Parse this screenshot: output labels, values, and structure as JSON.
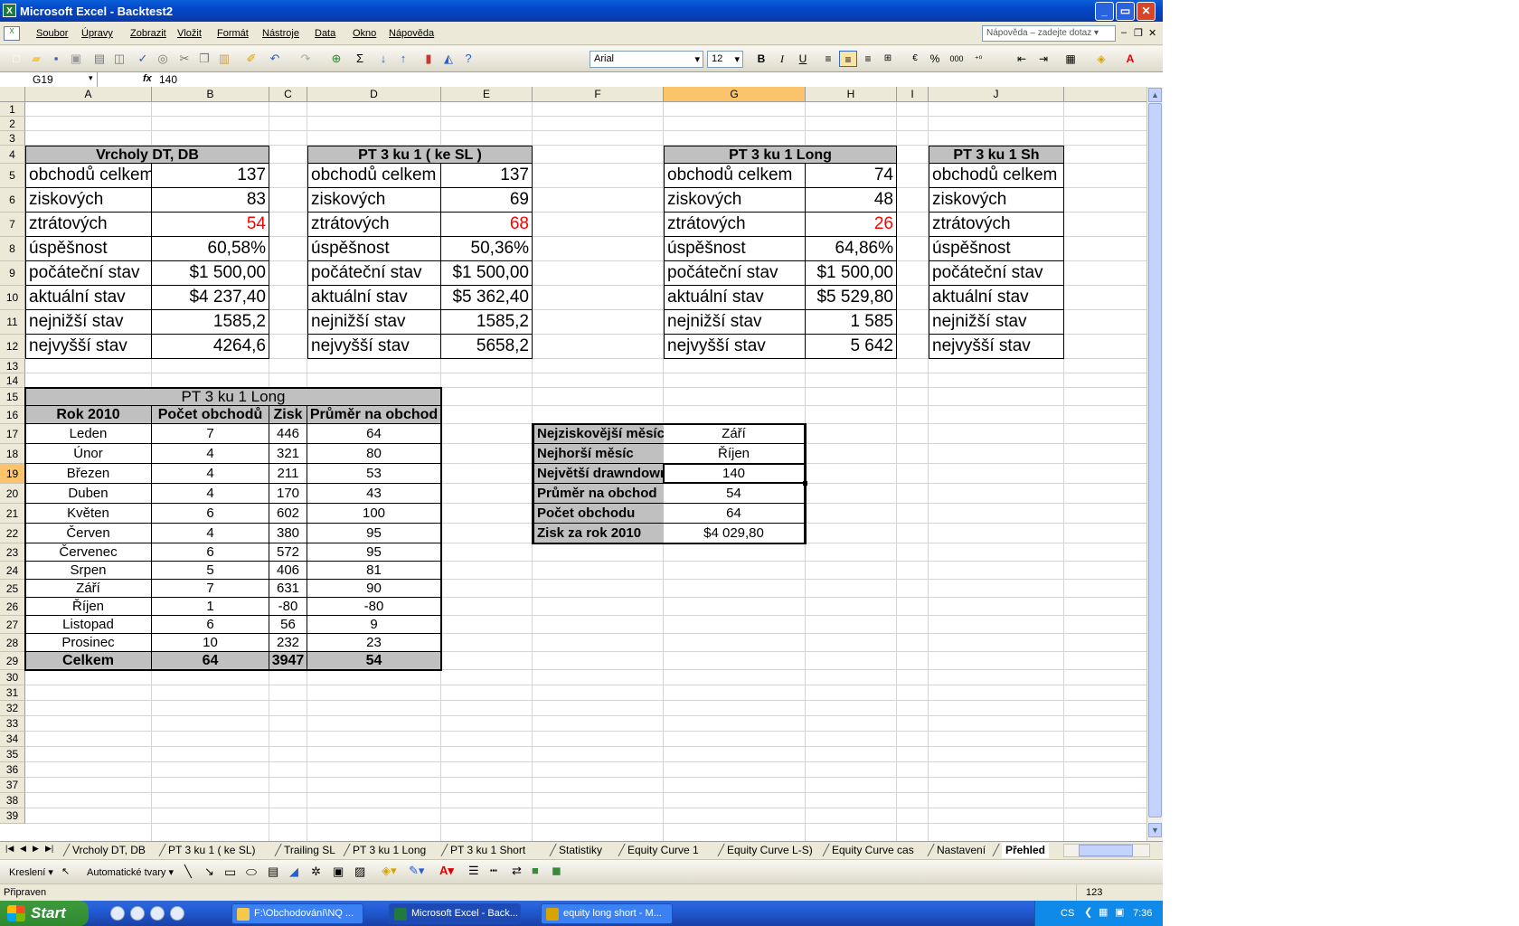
{
  "window": {
    "title": "Microsoft Excel - Backtest2"
  },
  "menu": [
    "Soubor",
    "Úpravy",
    "Zobrazit",
    "Vložit",
    "Formát",
    "Nástroje",
    "Data",
    "Okno",
    "Nápověda"
  ],
  "help_box": "Nápověda – zadejte dotaz",
  "toolbar": {
    "font": "Arial",
    "size": "12",
    "bold": "B",
    "italic": "I",
    "underline": "U",
    "percent": "%",
    "thousands": "000",
    "sigma": "Σ"
  },
  "formula_bar": {
    "name_box": "G19",
    "fx": "fx",
    "value": "140"
  },
  "columns": [
    {
      "l": "A",
      "w": 140
    },
    {
      "l": "B",
      "w": 130
    },
    {
      "l": "C",
      "w": 42
    },
    {
      "l": "D",
      "w": 148
    },
    {
      "l": "E",
      "w": 101
    },
    {
      "l": "F",
      "w": 145
    },
    {
      "l": "G",
      "w": 157
    },
    {
      "l": "H",
      "w": 101
    },
    {
      "l": "I",
      "w": 35
    },
    {
      "l": "J",
      "w": 150
    },
    {
      "l": "",
      "w": 100
    }
  ],
  "rows": [
    {
      "n": "1",
      "h": 16
    },
    {
      "n": "2",
      "h": 16
    },
    {
      "n": "3",
      "h": 16
    },
    {
      "n": "4",
      "h": 20
    },
    {
      "n": "5",
      "h": 27
    },
    {
      "n": "6",
      "h": 27
    },
    {
      "n": "7",
      "h": 27
    },
    {
      "n": "8",
      "h": 27
    },
    {
      "n": "9",
      "h": 27
    },
    {
      "n": "10",
      "h": 27
    },
    {
      "n": "11",
      "h": 27
    },
    {
      "n": "12",
      "h": 27
    },
    {
      "n": "13",
      "h": 16
    },
    {
      "n": "14",
      "h": 16
    },
    {
      "n": "15",
      "h": 20
    },
    {
      "n": "16",
      "h": 20
    },
    {
      "n": "17",
      "h": 22
    },
    {
      "n": "18",
      "h": 22
    },
    {
      "n": "19",
      "h": 22
    },
    {
      "n": "20",
      "h": 22
    },
    {
      "n": "21",
      "h": 22
    },
    {
      "n": "22",
      "h": 22
    },
    {
      "n": "23",
      "h": 20
    },
    {
      "n": "24",
      "h": 20
    },
    {
      "n": "25",
      "h": 20
    },
    {
      "n": "26",
      "h": 20
    },
    {
      "n": "27",
      "h": 20
    },
    {
      "n": "28",
      "h": 20
    },
    {
      "n": "29",
      "h": 20
    },
    {
      "n": "30",
      "h": 17
    },
    {
      "n": "31",
      "h": 17
    },
    {
      "n": "32",
      "h": 17
    },
    {
      "n": "33",
      "h": 17
    },
    {
      "n": "34",
      "h": 17
    },
    {
      "n": "35",
      "h": 17
    },
    {
      "n": "36",
      "h": 17
    },
    {
      "n": "37",
      "h": 17
    },
    {
      "n": "38",
      "h": 17
    },
    {
      "n": "39",
      "h": 17
    }
  ],
  "selected": {
    "col": "G",
    "row": "19"
  },
  "summary_labels": [
    "obchodů celkem",
    "ziskových",
    "ztrátových",
    "úspěšnost",
    "počáteční stav",
    "aktuální stav",
    "nejnižší stav",
    "nejvyšší stav"
  ],
  "summaries": [
    {
      "col": "A",
      "title": "Vrcholy DT, DB",
      "values": [
        "137",
        "83",
        "54",
        "60,58%",
        "$1 500,00",
        "$4 237,40",
        "1585,2",
        "4264,6"
      ]
    },
    {
      "col": "D",
      "title": "PT 3 ku 1 ( ke SL )",
      "values": [
        "137",
        "69",
        "68",
        "50,36%",
        "$1 500,00",
        "$5 362,40",
        "1585,2",
        "5658,2"
      ]
    },
    {
      "col": "G",
      "title": "PT 3 ku 1 Long",
      "values": [
        "74",
        "48",
        "26",
        "64,86%",
        "$1 500,00",
        "$5 529,80",
        "1 585",
        "5 642"
      ]
    },
    {
      "col": "J",
      "title": "PT 3 ku 1 Sh",
      "values": [
        "",
        "",
        "",
        "",
        "",
        "",
        "",
        ""
      ]
    }
  ],
  "monthly": {
    "title": "PT 3 ku 1 Long",
    "headers": [
      "Rok 2010",
      "Počet obchodů",
      "Zisk",
      "Průměr na obchod"
    ],
    "rows": [
      [
        "Leden",
        "7",
        "446",
        "64"
      ],
      [
        "Únor",
        "4",
        "321",
        "80"
      ],
      [
        "Březen",
        "4",
        "211",
        "53"
      ],
      [
        "Duben",
        "4",
        "170",
        "43"
      ],
      [
        "Květen",
        "6",
        "602",
        "100"
      ],
      [
        "Červen",
        "4",
        "380",
        "95"
      ],
      [
        "Červenec",
        "6",
        "572",
        "95"
      ],
      [
        "Srpen",
        "5",
        "406",
        "81"
      ],
      [
        "Září",
        "7",
        "631",
        "90"
      ],
      [
        "Říjen",
        "1",
        "-80",
        "-80"
      ],
      [
        "Listopad",
        "6",
        "56",
        "9"
      ],
      [
        "Prosinec",
        "10",
        "232",
        "23"
      ]
    ],
    "total": [
      "Celkem",
      "64",
      "3947",
      "54"
    ]
  },
  "stats": [
    [
      "Nejziskovější měsíc",
      "Září"
    ],
    [
      "Nejhorší měsíc",
      "Říjen"
    ],
    [
      "Největší drawndown",
      "140"
    ],
    [
      "Průměr na obchod",
      "54"
    ],
    [
      "Počet obchodu",
      "64"
    ],
    [
      "Zisk za rok 2010",
      "$4 029,80"
    ]
  ],
  "sheet_tabs": [
    "Vrcholy DT, DB",
    "PT 3 ku 1 ( ke SL)",
    "Trailing SL",
    "PT 3 ku 1 Long",
    "PT 3 ku 1 Short",
    "Statistiky",
    "Equity Curve 1",
    "Equity Curve L-S)",
    "Equity Curve cas",
    "Nastavení",
    "Přehled"
  ],
  "active_tab": "Přehled",
  "drawing": {
    "draw": "Kreslení",
    "autoshapes": "Automatické tvary"
  },
  "status": {
    "text": "Připraven",
    "right": "123"
  },
  "taskbar": {
    "start": "Start",
    "tasks": [
      "F:\\Obchodování\\NQ ...",
      "Microsoft Excel - Back...",
      "equity long short - M..."
    ],
    "lang": "CS",
    "clock": "7:36"
  }
}
